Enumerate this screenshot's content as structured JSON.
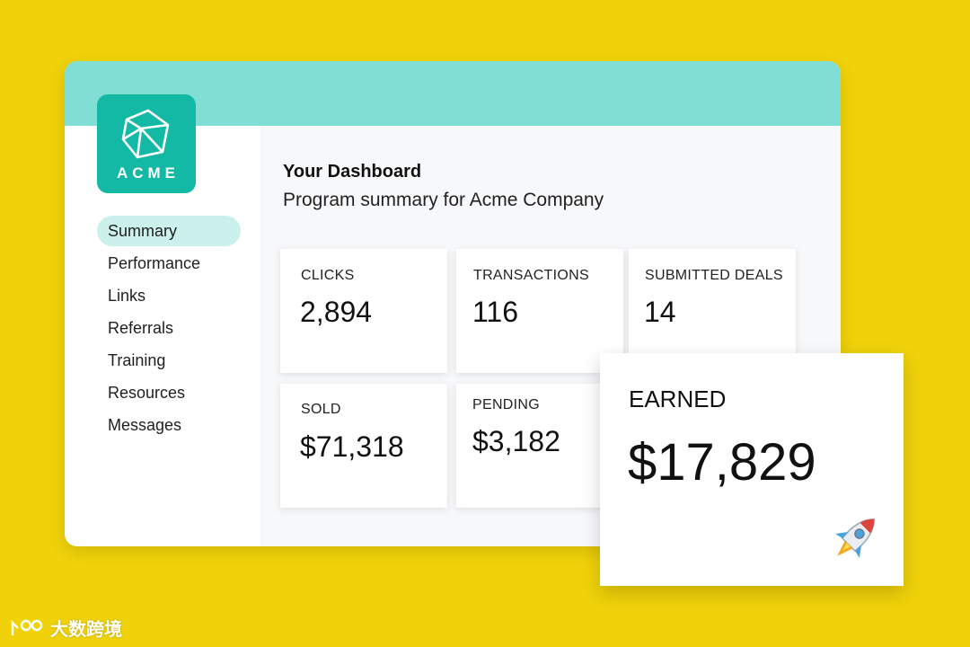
{
  "brand": {
    "logo_text": "ACME"
  },
  "nav": {
    "items": [
      {
        "label": "Summary",
        "active": true
      },
      {
        "label": "Performance",
        "active": false
      },
      {
        "label": "Links",
        "active": false
      },
      {
        "label": "Referrals",
        "active": false
      },
      {
        "label": "Training",
        "active": false
      },
      {
        "label": "Resources",
        "active": false
      },
      {
        "label": "Messages",
        "active": false
      }
    ]
  },
  "dashboard": {
    "title": "Your Dashboard",
    "subtitle": "Program summary for Acme Company"
  },
  "stats": {
    "clicks": {
      "label": "CLICKS",
      "value": "2,894"
    },
    "transactions": {
      "label": "TRANSACTIONS",
      "value": "116"
    },
    "submitted_deals": {
      "label": "SUBMITTED DEALS",
      "value": "14"
    },
    "sold": {
      "label": "SOLD",
      "value": "$71,318"
    },
    "pending": {
      "label": "PENDING",
      "value": "$3,182"
    },
    "earned": {
      "label": "EARNED",
      "value": "$17,829"
    }
  },
  "icons": {
    "logo": "polyhedron-icon",
    "earned": "rocket-icon",
    "watermark": "watermark-logo-icon"
  },
  "colors": {
    "background": "#efd20a",
    "header": "#80ded4",
    "logo_bg": "#14b9a6",
    "active_nav": "#ccf1ec"
  },
  "watermark": {
    "text": "大数跨境"
  }
}
